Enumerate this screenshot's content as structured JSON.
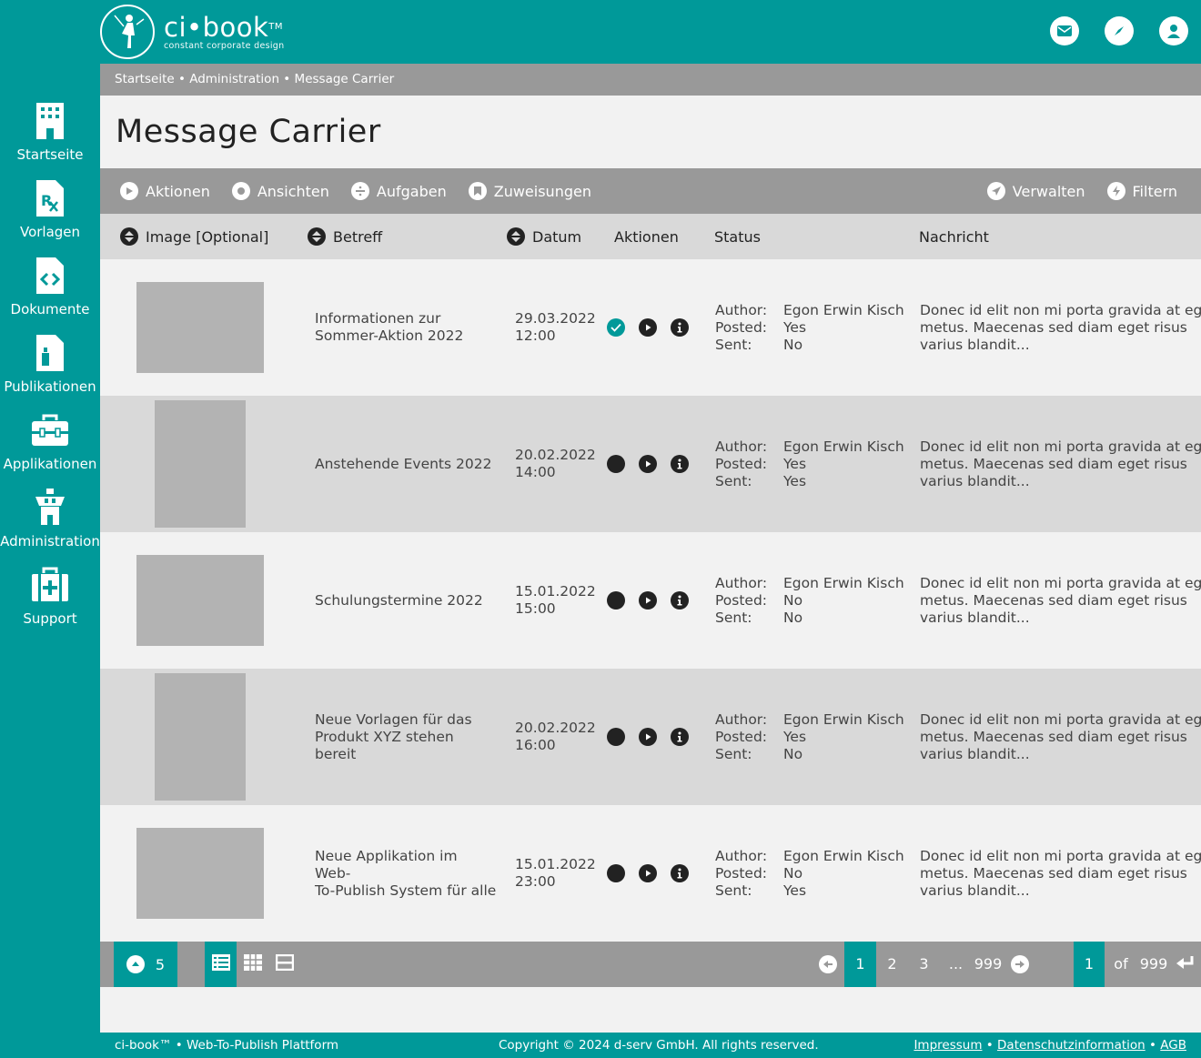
{
  "brand": {
    "name": "ci•book",
    "tm": "TM",
    "tagline": "constant corporate design"
  },
  "topbar": {
    "icons": [
      "mail-icon",
      "compass-icon",
      "user-icon"
    ]
  },
  "sidebar": {
    "items": [
      {
        "label": "Startseite",
        "icon": "building-icon"
      },
      {
        "label": "Vorlagen",
        "icon": "prescription-file-icon"
      },
      {
        "label": "Dokumente",
        "icon": "code-file-icon"
      },
      {
        "label": "Publikationen",
        "icon": "bottle-file-icon"
      },
      {
        "label": "Applikationen",
        "icon": "toolbox-icon"
      },
      {
        "label": "Administration",
        "icon": "tower-icon"
      },
      {
        "label": "Support",
        "icon": "medical-kit-icon"
      }
    ]
  },
  "breadcrumb": "Startseite • Administration • Message Carrier",
  "page_title": "Message Carrier",
  "toolbar": {
    "left": [
      "Aktionen",
      "Ansichten",
      "Aufgaben",
      "Zuweisungen"
    ],
    "right": [
      "Verwalten",
      "Filtern"
    ]
  },
  "columns": {
    "image": "Image [Optional]",
    "subject": "Betreff",
    "date": "Datum",
    "actions": "Aktionen",
    "status": "Status",
    "message": "Nachricht"
  },
  "status_labels": {
    "author": "Author:",
    "posted": "Posted:",
    "sent": "Sent:"
  },
  "rows": [
    {
      "subject": [
        "Informationen zur",
        "Sommer-Aktion 2022"
      ],
      "date": "29.03.2022",
      "time": "12:00",
      "author": "Egon Erwin Kisch",
      "posted": "Yes",
      "sent": "No",
      "done": true,
      "orient": "land",
      "message": [
        "Donec id elit non mi porta gravida at eget",
        "metus. Maecenas sed diam eget risus",
        "varius blandit..."
      ]
    },
    {
      "subject": [
        "Anstehende Events 2022"
      ],
      "date": "20.02.2022",
      "time": "14:00",
      "author": "Egon Erwin Kisch",
      "posted": "Yes",
      "sent": "Yes",
      "done": false,
      "orient": "port",
      "message": [
        "Donec id elit non mi porta gravida at eget",
        "metus. Maecenas sed diam eget risus",
        "varius blandit..."
      ]
    },
    {
      "subject": [
        "Schulungstermine 2022"
      ],
      "date": "15.01.2022",
      "time": "15:00",
      "author": "Egon Erwin Kisch",
      "posted": "No",
      "sent": "No",
      "done": false,
      "orient": "land",
      "message": [
        "Donec id elit non mi porta gravida at eget",
        "metus. Maecenas sed diam eget risus",
        "varius blandit..."
      ]
    },
    {
      "subject": [
        "Neue Vorlagen für das",
        "Produkt XYZ stehen bereit"
      ],
      "date": "20.02.2022",
      "time": "16:00",
      "author": "Egon Erwin Kisch",
      "posted": "Yes",
      "sent": "No",
      "done": false,
      "orient": "port",
      "message": [
        "Donec id elit non mi porta gravida at eget",
        "metus. Maecenas sed diam eget risus",
        "varius blandit..."
      ]
    },
    {
      "subject": [
        "Neue Applikation im Web-",
        "To-Publish System für alle"
      ],
      "date": "15.01.2022",
      "time": "23:00",
      "author": "Egon Erwin Kisch",
      "posted": "No",
      "sent": "Yes",
      "done": false,
      "orient": "land",
      "message": [
        "Donec id elit non mi porta gravida at eget",
        "metus. Maecenas sed diam eget risus",
        "varius blandit..."
      ]
    }
  ],
  "pager": {
    "per_page": "5",
    "pages": [
      "1",
      "2",
      "3",
      "...",
      "999"
    ],
    "current": "1",
    "of": "of",
    "total": "999"
  },
  "footer": {
    "left": "ci-book™ • Web-To-Publish Plattform",
    "center": "Copyright © 2024 d-serv GmbH. All rights reserved.",
    "links": [
      "Impressum",
      "Datenschutzinformation",
      "AGB"
    ],
    "sep": " • "
  },
  "colors": {
    "teal": "#009999",
    "gray": "#999999",
    "light": "#f2f2f2",
    "row_alt": "#d9d9d9"
  }
}
